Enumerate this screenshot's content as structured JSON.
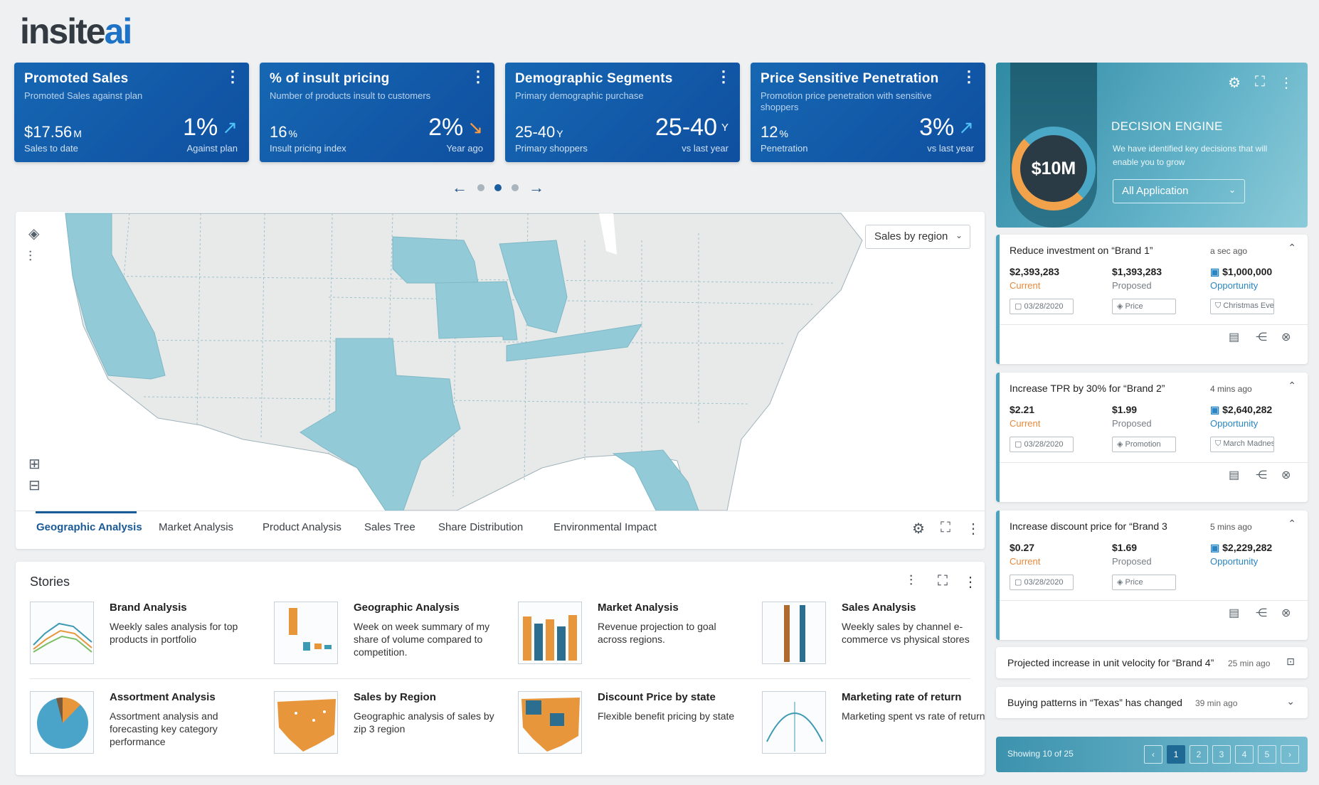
{
  "brand": {
    "part1": "insite",
    "part2": "ai"
  },
  "kpis": [
    {
      "title": "Promoted Sales",
      "sub": "Promoted Sales against plan",
      "left_value": "$17.56",
      "left_unit": "M",
      "left_label": "Sales to date",
      "right_value": "1%",
      "right_label": "Against plan",
      "trend": "up"
    },
    {
      "title": "% of insult pricing",
      "sub": "Number of products insult to customers",
      "left_value": "16",
      "left_unit": "%",
      "left_label": "Insult pricing index",
      "right_value": "2%",
      "right_label": "Year ago",
      "trend": "down"
    },
    {
      "title": "Demographic Segments",
      "sub": "Primary demographic purchase",
      "left_value": "25-40",
      "left_unit": "Y",
      "left_label": "Primary shoppers",
      "right_value": "25-40",
      "right_unit": "Y",
      "right_label": "vs last year",
      "trend": "none"
    },
    {
      "title": "Price Sensitive Penetration",
      "sub": "Promotion price penetration with sensitive shoppers",
      "left_value": "12",
      "left_unit": "%",
      "left_label": "Penetration",
      "right_value": "3%",
      "right_label": "vs last year",
      "trend": "up"
    }
  ],
  "carousel": {
    "prev": "←",
    "next": "→",
    "active_index": 1,
    "count": 3
  },
  "map": {
    "select_value": "Sales by region",
    "highlighted_states": [
      "California",
      "Nebraska",
      "Missouri",
      "Illinois",
      "Tennessee",
      "Texas",
      "Florida"
    ],
    "highlight_color": "#93cad7",
    "base_color": "#e8eaea"
  },
  "tabs": [
    "Geographic Analysis",
    "Market Analysis",
    "Product Analysis",
    "Sales Tree",
    "Share Distribution",
    "Environmental Impact"
  ],
  "stories": {
    "heading": "Stories",
    "items": [
      {
        "title": "Brand Analysis",
        "desc": "Weekly sales analysis for top products in portfolio"
      },
      {
        "title": "Geographic Analysis",
        "desc": "Week on week summary of my share of volume compared to competition."
      },
      {
        "title": "Market Analysis",
        "desc": "Revenue projection to goal across regions."
      },
      {
        "title": "Sales Analysis",
        "desc": "Weekly sales by channel e-commerce vs physical stores"
      },
      {
        "title": "Assortment Analysis",
        "desc": "Assortment analysis and forecasting key category performance"
      },
      {
        "title": "Sales by Region",
        "desc": "Geographic analysis of sales by zip 3 region"
      },
      {
        "title": "Discount Price by state",
        "desc": "Flexible benefit pricing by state"
      },
      {
        "title": "Marketing rate of return",
        "desc": "Marketing spent vs rate of return"
      }
    ]
  },
  "engine": {
    "amount": "$10M",
    "title": "DECISION ENGINE",
    "desc": "We have identified key decisions that will enable you to grow",
    "select_value": "All Application"
  },
  "recommendations": [
    {
      "title": "Reduce investment on “Brand 1”",
      "ago": "a sec ago",
      "current": "$2,393,283",
      "proposed": "$1,393,283",
      "opportunity": "$1,000,000",
      "date": "03/28/2020",
      "type": "Price",
      "event": "Christmas Event"
    },
    {
      "title": "Increase TPR by 30% for “Brand 2”",
      "ago": "4 mins ago",
      "current": "$2.21",
      "proposed": "$1.99",
      "opportunity": "$2,640,282",
      "date": "03/28/2020",
      "type": "Promotion",
      "event": "March Madness"
    },
    {
      "title": "Increase discount price for “Brand 3",
      "ago": "5 mins ago",
      "current": "$0.27",
      "proposed": "$1.69",
      "opportunity": "$2,229,282",
      "date": "03/28/2020",
      "type": "Price",
      "event": ""
    }
  ],
  "labels": {
    "current": "Current",
    "proposed": "Proposed",
    "opportunity": "Opportunity"
  },
  "alerts": [
    {
      "text": "Projected increase in unit velocity for “Brand 4”",
      "ago": "25 min ago"
    },
    {
      "text": "Buying patterns in “Texas” has changed",
      "ago": "39 min ago"
    }
  ],
  "paging": {
    "text": "Showing 10 of 25",
    "pages": [
      "1",
      "2",
      "3",
      "4",
      "5"
    ],
    "active_page": "1"
  }
}
